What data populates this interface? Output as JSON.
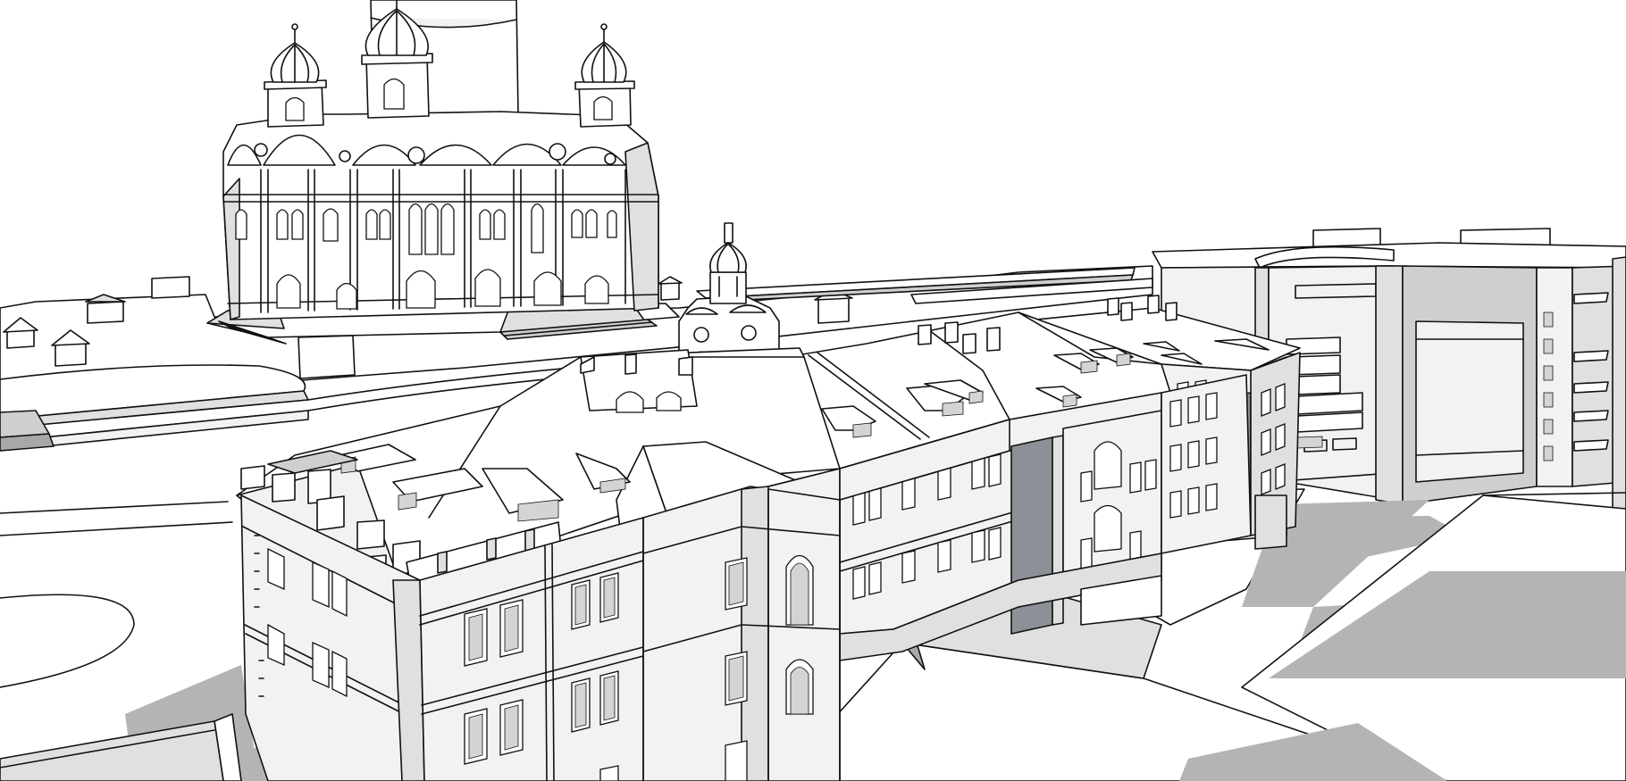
{
  "scene": {
    "kind": "sketch-3d-model-view",
    "style": "hidden-line with monochrome shadows",
    "colors": {
      "background": "#ffffff",
      "edges": "#111111",
      "shadow": "#b4b4b4",
      "facade_light": "#f2f2f2",
      "facade_shade": "#d8d8d8",
      "recess": "#8c9198"
    },
    "objects": [
      {
        "id": "cathedral",
        "icon": "domed-cathedral-icon"
      },
      {
        "id": "chapel",
        "icon": "small-dome-chapel-icon"
      },
      {
        "id": "historic-block",
        "icon": "building-icon"
      },
      {
        "id": "modern-block",
        "icon": "office-tower-icon"
      },
      {
        "id": "plaza",
        "icon": "plaza-icon"
      }
    ]
  }
}
